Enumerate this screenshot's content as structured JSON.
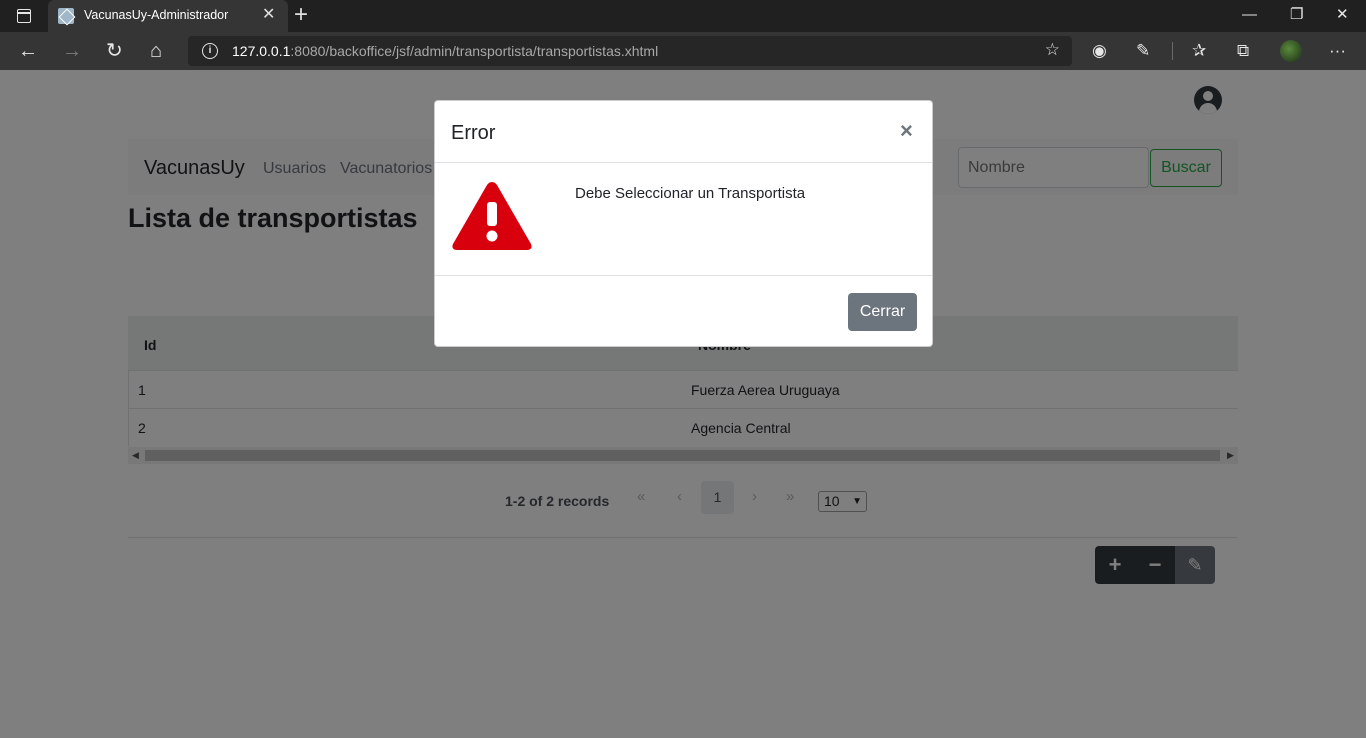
{
  "browser": {
    "tab_title": "VacunasUy-Administrador",
    "url_host": "127.0.0.1",
    "url_rest": ":8080/backoffice/jsf/admin/transportista/transportistas.xhtml"
  },
  "navbar": {
    "brand": "VacunasUy",
    "links": [
      "Usuarios",
      "Vacunatorios"
    ],
    "search_placeholder": "Nombre",
    "search_button": "Buscar"
  },
  "page": {
    "title": "Lista de transportistas"
  },
  "table": {
    "headers": [
      "Id",
      "Nombre"
    ],
    "rows": [
      {
        "id": "1",
        "nombre": "Fuerza Aerea Uruguaya"
      },
      {
        "id": "2",
        "nombre": "Agencia Central"
      }
    ]
  },
  "paginator": {
    "records": "1-2 of 2 records",
    "current_page": "1",
    "first": "«",
    "prev": "‹",
    "next": "›",
    "last": "»",
    "rows_per_page": "10"
  },
  "actions": {
    "add": "+",
    "remove": "−",
    "edit": "✎"
  },
  "modal": {
    "title": "Error",
    "close_symbol": "×",
    "message": "Debe Seleccionar un Transportista",
    "button": "Cerrar"
  },
  "colors": {
    "warning_red": "#d9000d",
    "success_green": "#28a745",
    "secondary": "#6c757d",
    "dark": "#343a40"
  }
}
